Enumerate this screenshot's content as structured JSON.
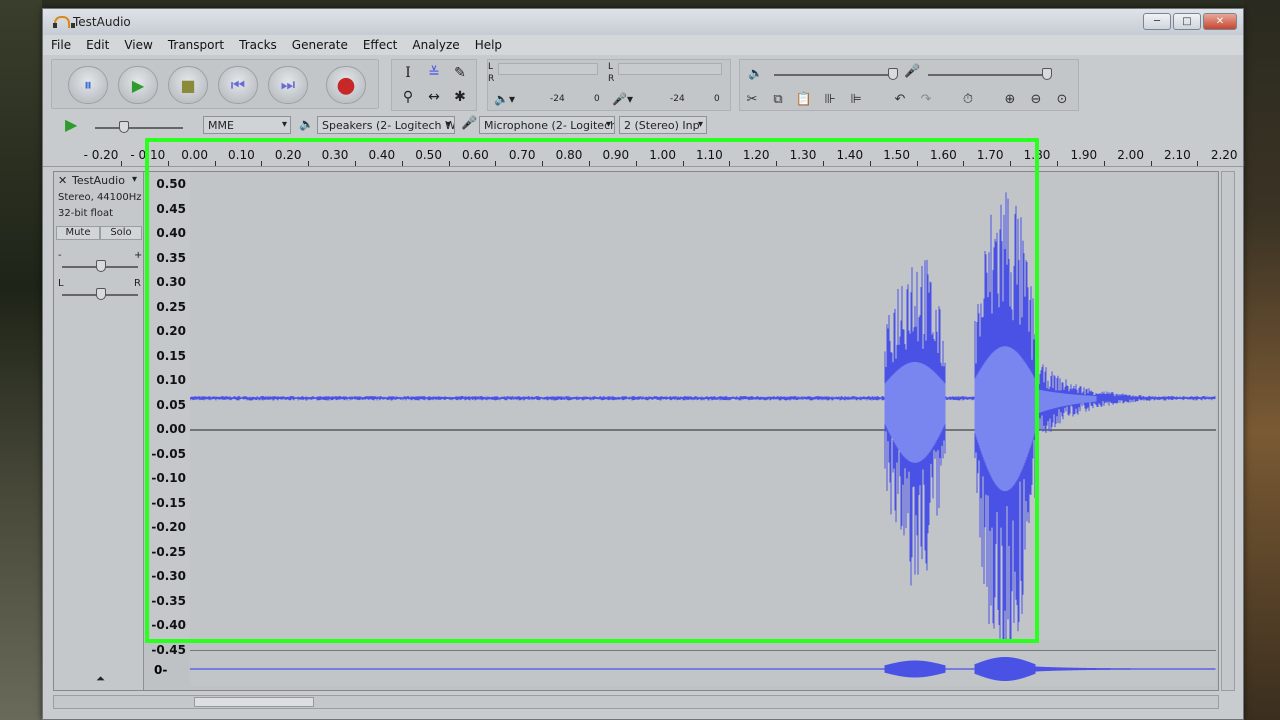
{
  "window": {
    "title": "TestAudio",
    "controls": {
      "minimize": "─",
      "maximize": "□",
      "close": "✕"
    }
  },
  "menu": [
    "File",
    "Edit",
    "View",
    "Transport",
    "Tracks",
    "Generate",
    "Effect",
    "Analyze",
    "Help"
  ],
  "transport": {
    "buttons": [
      {
        "name": "pause-button",
        "icon": "⏸",
        "color": "#3b6ed6"
      },
      {
        "name": "play-button",
        "icon": "▶",
        "color": "#2e9b2e"
      },
      {
        "name": "stop-button",
        "icon": "■",
        "color": "#8a8a3a"
      },
      {
        "name": "skip-start-button",
        "icon": "⏮",
        "color": "#6a6ad6"
      },
      {
        "name": "skip-end-button",
        "icon": "⏭",
        "color": "#6a6ad6"
      },
      {
        "name": "record-button",
        "icon": "●",
        "color": "#c62828"
      }
    ]
  },
  "meters": {
    "lr_top": "L",
    "lr_bottom": "R",
    "play_scale": [
      "-24",
      "0"
    ],
    "rec_scale": [
      "-24",
      "0"
    ]
  },
  "devices": {
    "host": "MME",
    "output": "Speakers (2- Logitech W",
    "input": "Microphone (2- Logitech",
    "channels": "2 (Stereo) Inp"
  },
  "ruler": {
    "labels": [
      "- 0.20",
      "- 0.10",
      "0.00",
      "0.10",
      "0.20",
      "0.30",
      "0.40",
      "0.50",
      "0.60",
      "0.70",
      "0.80",
      "0.90",
      "1.00",
      "1.10",
      "1.20",
      "1.30",
      "1.40",
      "1.50",
      "1.60",
      "1.70",
      "1.80",
      "1.90",
      "2.00",
      "2.10",
      "2.20"
    ]
  },
  "track": {
    "name": "TestAudio",
    "format": "Stereo, 44100Hz",
    "depth": "32-bit float",
    "mute": "Mute",
    "solo": "Solo",
    "gain_minus": "-",
    "gain_plus": "+",
    "pan_left": "L",
    "pan_right": "R"
  },
  "amplitude_scale": [
    "0.50",
    "0.45",
    "0.40",
    "0.35",
    "0.30",
    "0.25",
    "0.20",
    "0.15",
    "0.10",
    "0.05",
    "0.00",
    "-0.05",
    "-0.10",
    "-0.15",
    "-0.20",
    "-0.25",
    "-0.30",
    "-0.35",
    "-0.40",
    "-0.45"
  ],
  "track2_scale": "0-",
  "colors": {
    "waveform": "#4a52e6",
    "waveform_rms": "#7a86f0",
    "highlight": "#2bff1f"
  }
}
